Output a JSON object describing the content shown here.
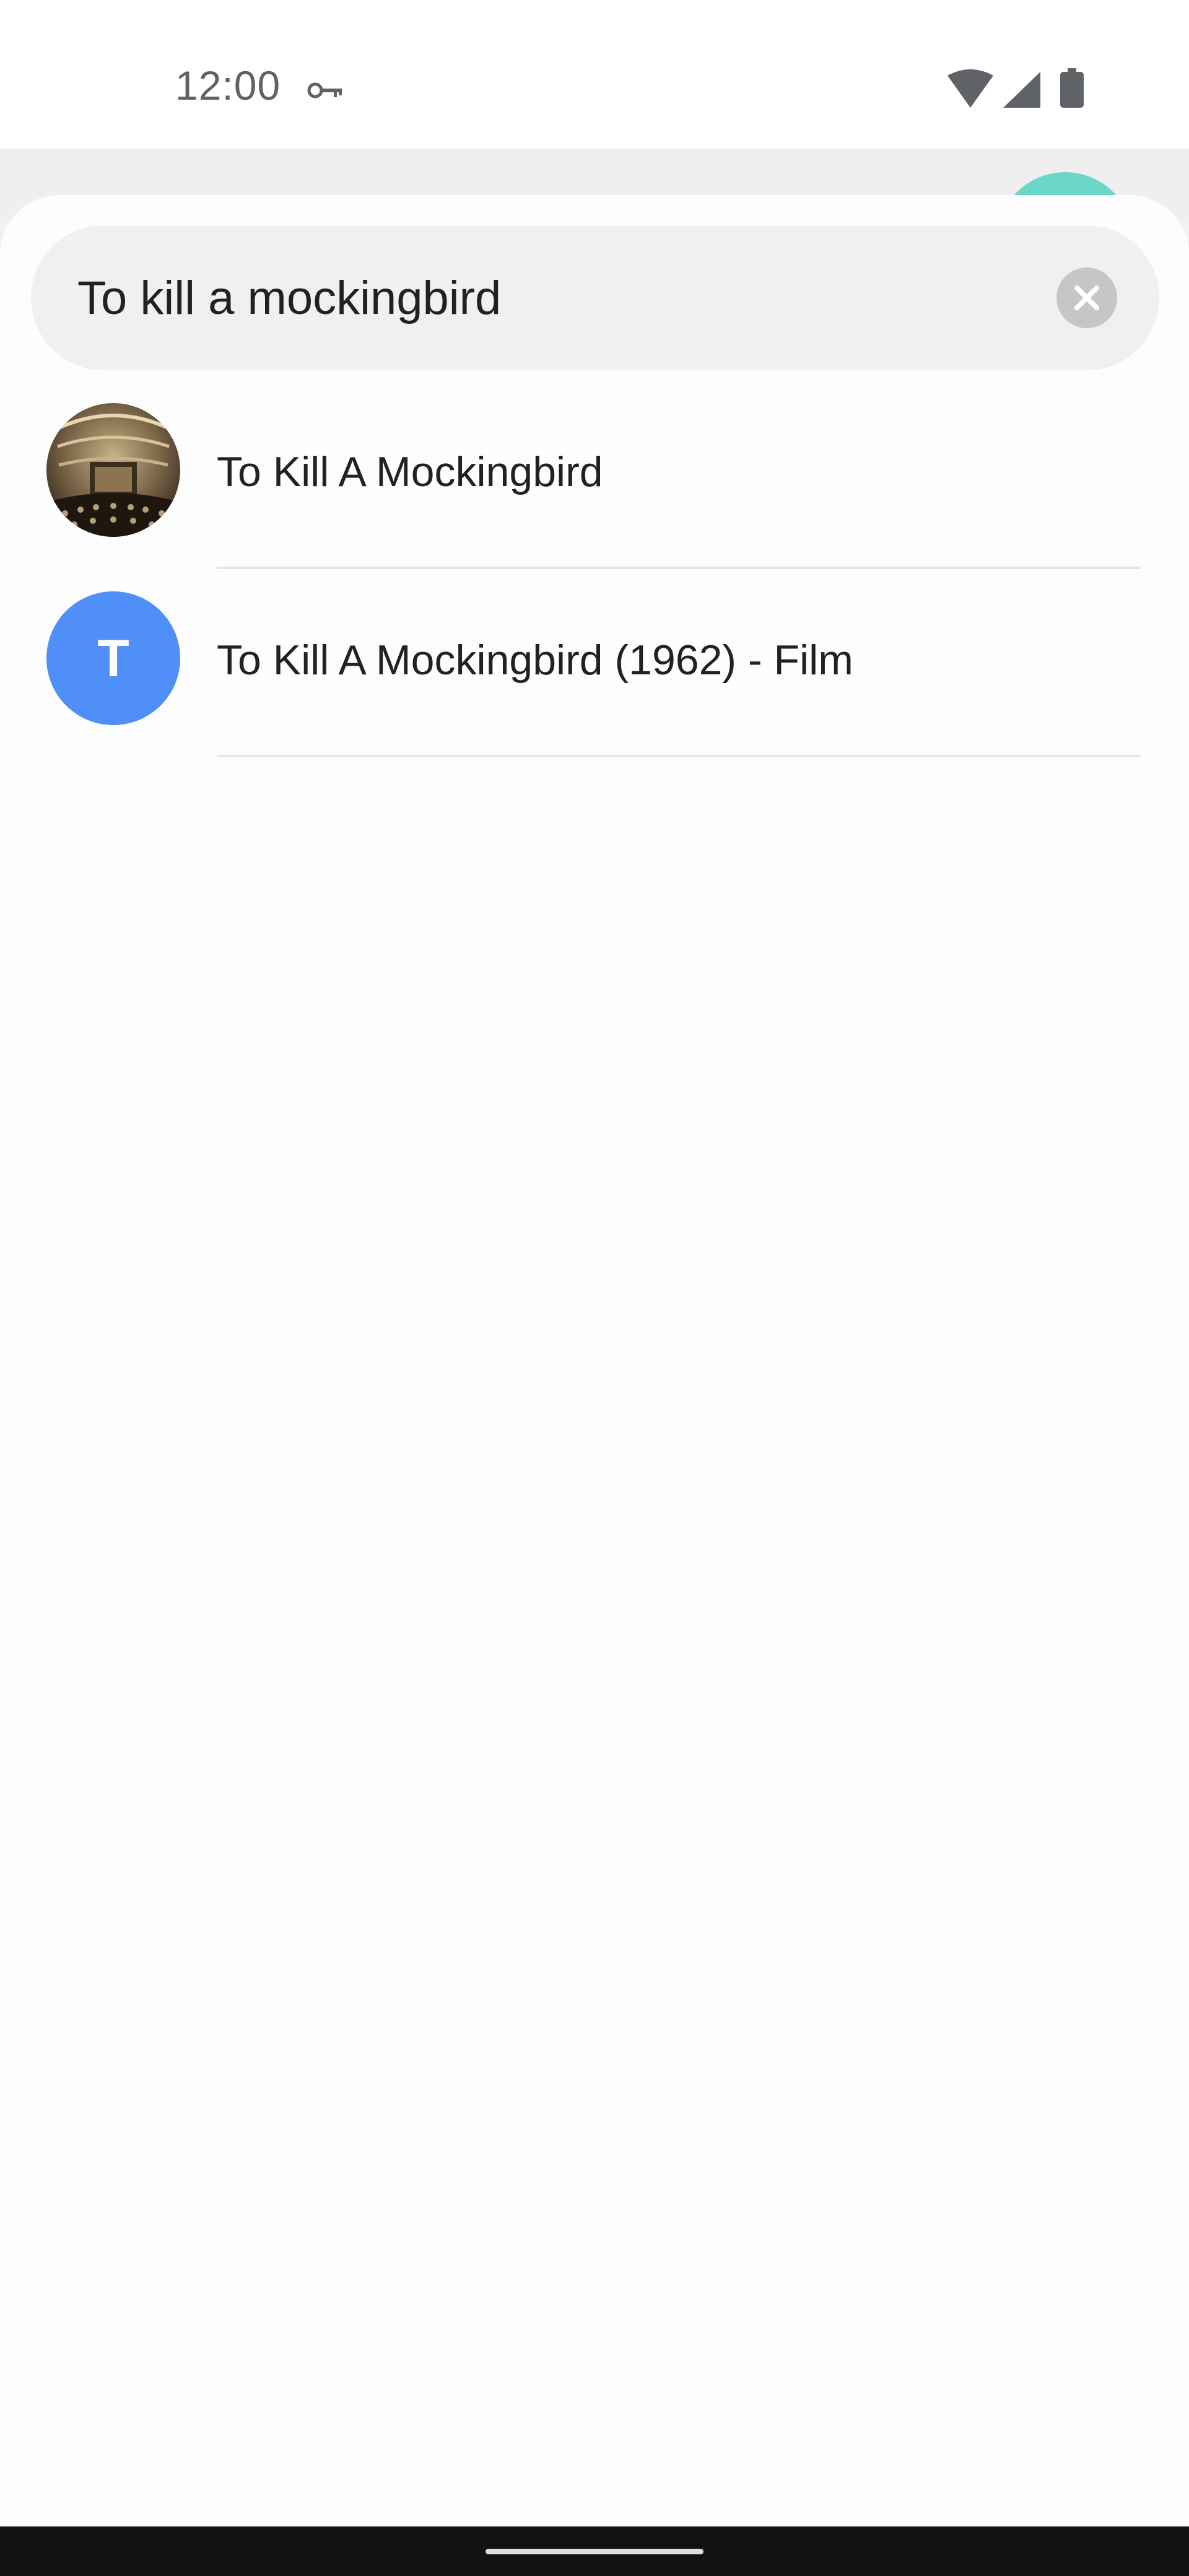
{
  "status_bar": {
    "time": "12:00",
    "icons": [
      "vpn-key-icon",
      "wifi-icon",
      "cell-signal-icon",
      "battery-icon"
    ]
  },
  "search": {
    "query": "To kill a mockingbird",
    "clear_icon": "close-icon"
  },
  "results": [
    {
      "title": "To Kill A Mockingbird",
      "avatar_type": "image"
    },
    {
      "title": "To Kill A Mockingbird (1962) - Film",
      "avatar_type": "letter",
      "avatar_letter": "T",
      "avatar_color": "#4f8ff7"
    }
  ],
  "colors": {
    "accent_teal": "#6ad7c8",
    "letter_avatar": "#4f8ff7",
    "search_bg": "#f0f0f0"
  }
}
